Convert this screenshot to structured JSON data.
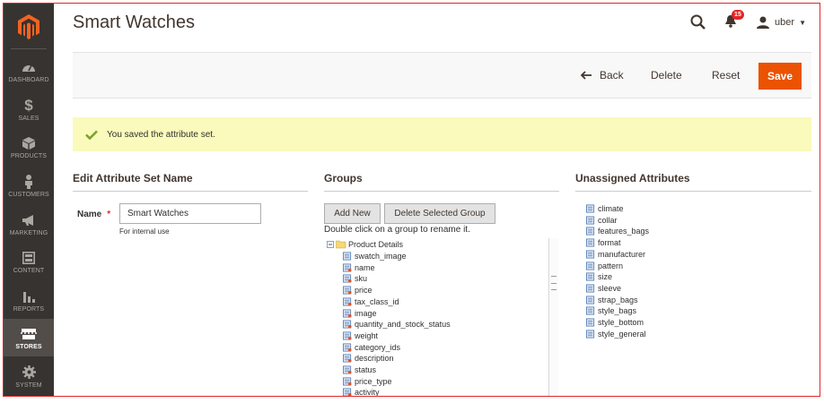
{
  "nav": {
    "items": [
      {
        "label": "DASHBOARD",
        "icon": "gauge-icon"
      },
      {
        "label": "SALES",
        "icon": "dollar-icon"
      },
      {
        "label": "PRODUCTS",
        "icon": "cube-icon"
      },
      {
        "label": "CUSTOMERS",
        "icon": "person-icon"
      },
      {
        "label": "MARKETING",
        "icon": "megaphone-icon"
      },
      {
        "label": "CONTENT",
        "icon": "layout-icon"
      },
      {
        "label": "REPORTS",
        "icon": "bar-chart-icon"
      },
      {
        "label": "STORES",
        "icon": "store-icon"
      },
      {
        "label": "SYSTEM",
        "icon": "gear-icon"
      }
    ],
    "active": "STORES"
  },
  "page": {
    "title": "Smart Watches"
  },
  "header": {
    "notifications_count": "15",
    "user_name": "uber"
  },
  "actions": {
    "back_label": "Back",
    "delete_label": "Delete",
    "reset_label": "Reset",
    "save_label": "Save"
  },
  "message": {
    "text": "You saved the attribute set."
  },
  "edit_section": {
    "title": "Edit Attribute Set Name",
    "name_label": "Name",
    "required_mark": "*",
    "name_value": "Smart Watches",
    "note": "For internal use"
  },
  "groups": {
    "title": "Groups",
    "add_new_label": "Add New",
    "delete_group_label": "Delete Selected Group",
    "hint": "Double click on a group to rename it.",
    "root_label": "Product Details",
    "items": [
      "swatch_image",
      "name",
      "sku",
      "price",
      "tax_class_id",
      "image",
      "quantity_and_stock_status",
      "weight",
      "category_ids",
      "description",
      "status",
      "price_type",
      "activity"
    ]
  },
  "unassigned": {
    "title": "Unassigned Attributes",
    "items": [
      "climate",
      "collar",
      "features_bags",
      "format",
      "manufacturer",
      "pattern",
      "size",
      "sleeve",
      "strap_bags",
      "style_bags",
      "style_bottom",
      "style_general"
    ]
  },
  "colors": {
    "accent": "#eb5202",
    "sidebar": "#373330",
    "message_bg": "#fafabc",
    "badge": "#e22626"
  }
}
